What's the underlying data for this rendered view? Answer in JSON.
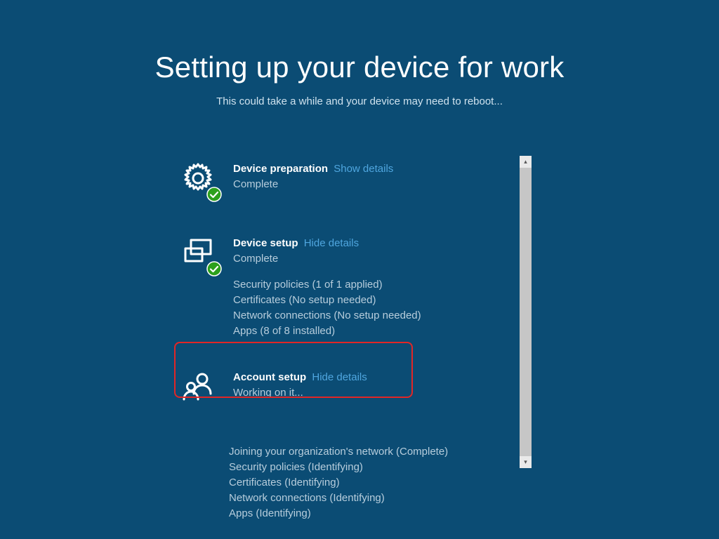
{
  "header": {
    "title": "Setting up your device for work",
    "subtitle": "This could take a while and your device may need to reboot..."
  },
  "stages": {
    "devicePreparation": {
      "title": "Device preparation",
      "toggle": "Show details",
      "status": "Complete"
    },
    "deviceSetup": {
      "title": "Device setup",
      "toggle": "Hide details",
      "status": "Complete",
      "details": {
        "securityPolicies": "Security policies (1 of 1 applied)",
        "certificates": "Certificates (No setup needed)",
        "networkConnections": "Network connections (No setup needed)",
        "apps": "Apps (8 of 8 installed)"
      }
    },
    "accountSetup": {
      "title": "Account setup",
      "toggle": "Hide details",
      "status": "Working on it...",
      "details": {
        "joining": "Joining your organization's network (Complete)",
        "securityPolicies": "Security policies (Identifying)",
        "certificates": "Certificates (Identifying)",
        "networkConnections": "Network connections (Identifying)",
        "apps": "Apps (Identifying)"
      }
    }
  },
  "colors": {
    "background": "#0b4c74",
    "accentLink": "#4fa6df",
    "mutedText": "#b7cddc",
    "highlightBorder": "#e22626",
    "checkmarkGreen": "#2ca01c"
  }
}
